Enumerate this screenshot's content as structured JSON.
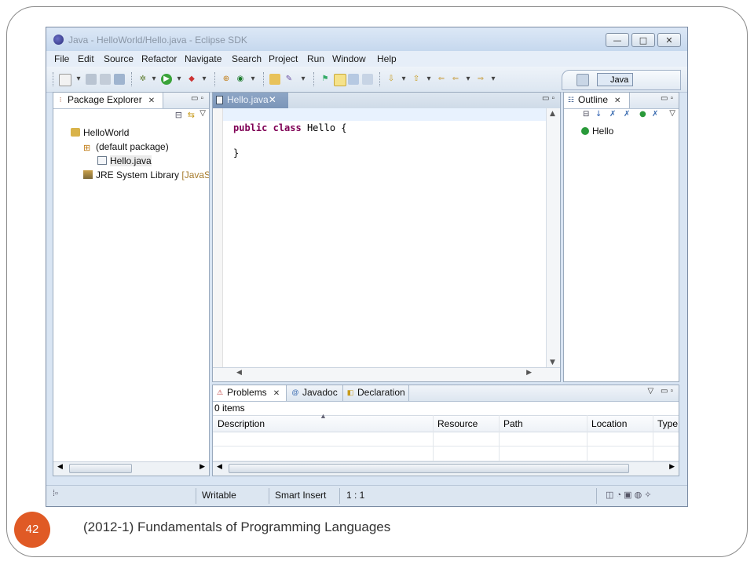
{
  "window": {
    "title": "Java - HelloWorld/Hello.java - Eclipse SDK",
    "controls": [
      "—",
      "□",
      "✕"
    ]
  },
  "menu": [
    "File",
    "Edit",
    "Source",
    "Refactor",
    "Navigate",
    "Search",
    "Project",
    "Run",
    "Window",
    "Help"
  ],
  "perspective": {
    "label": "Java"
  },
  "package_explorer": {
    "tab_label": "Package Explorer",
    "tree": [
      {
        "label": "HelloWorld"
      },
      {
        "label": "(default package)"
      },
      {
        "label": "Hello.java"
      },
      {
        "label": "JRE System Library",
        "suffix": "[JavaSE"
      }
    ]
  },
  "editor": {
    "tab_label": "Hello.java",
    "code_line1_kw1": "public",
    "code_line1_kw2": "class",
    "code_line1_rest": " Hello {",
    "code_line3": "}"
  },
  "outline": {
    "tab_label": "Outline",
    "items": [
      {
        "label": "Hello"
      }
    ]
  },
  "bottom": {
    "tabs": [
      "Problems",
      "Javadoc",
      "Declaration"
    ],
    "summary": "0 items",
    "columns": [
      "Description",
      "Resource",
      "Path",
      "Location",
      "Type"
    ]
  },
  "status": {
    "writable": "Writable",
    "insert_mode": "Smart Insert",
    "position": "1 : 1"
  },
  "slide": {
    "page_number": "42",
    "footer": "(2012-1) Fundamentals of Programming Languages"
  },
  "colors": {
    "keyword": "#7f0055",
    "page_badge": "#e05a25"
  }
}
